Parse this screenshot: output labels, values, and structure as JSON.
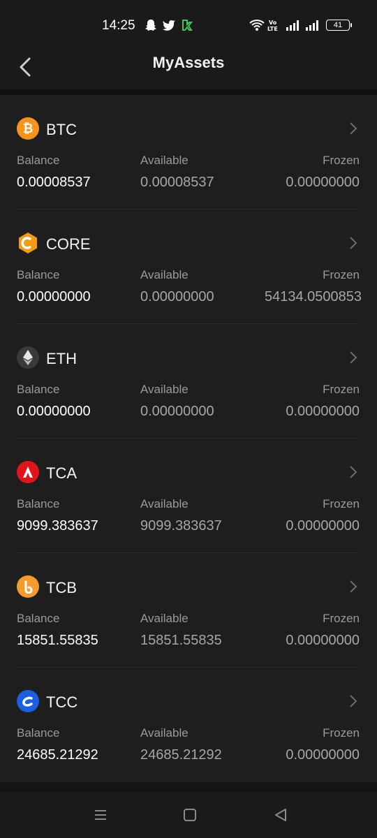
{
  "status_bar": {
    "time": "14:25",
    "battery": "41",
    "icons": [
      "snapchat-icon",
      "twitter-icon",
      "app-icon",
      "wifi-icon",
      "volte-icon",
      "signal-icon"
    ]
  },
  "header": {
    "title": "MyAssets",
    "back_icon": "chevron-left-icon"
  },
  "labels": {
    "balance": "Balance",
    "available": "Available",
    "frozen": "Frozen"
  },
  "assets": [
    {
      "symbol": "BTC",
      "balance": "0.00008537",
      "available": "0.00008537",
      "frozen": "0.00000000",
      "color": "#f7931a"
    },
    {
      "symbol": "CORE",
      "balance": "0.00000000",
      "available": "0.00000000",
      "frozen": "54134.0500853",
      "color": "#f39c12"
    },
    {
      "symbol": "ETH",
      "balance": "0.00000000",
      "available": "0.00000000",
      "frozen": "0.00000000",
      "color": "#3a3a3a"
    },
    {
      "symbol": "TCA",
      "balance": "9099.383637",
      "available": "9099.383637",
      "frozen": "0.00000000",
      "color": "#e0151b"
    },
    {
      "symbol": "TCB",
      "balance": "15851.55835",
      "available": "15851.55835",
      "frozen": "0.00000000",
      "color": "#f59a2c"
    },
    {
      "symbol": "TCC",
      "balance": "24685.21292",
      "available": "24685.21292",
      "frozen": "0.00000000",
      "color": "#1c5fe0"
    }
  ]
}
